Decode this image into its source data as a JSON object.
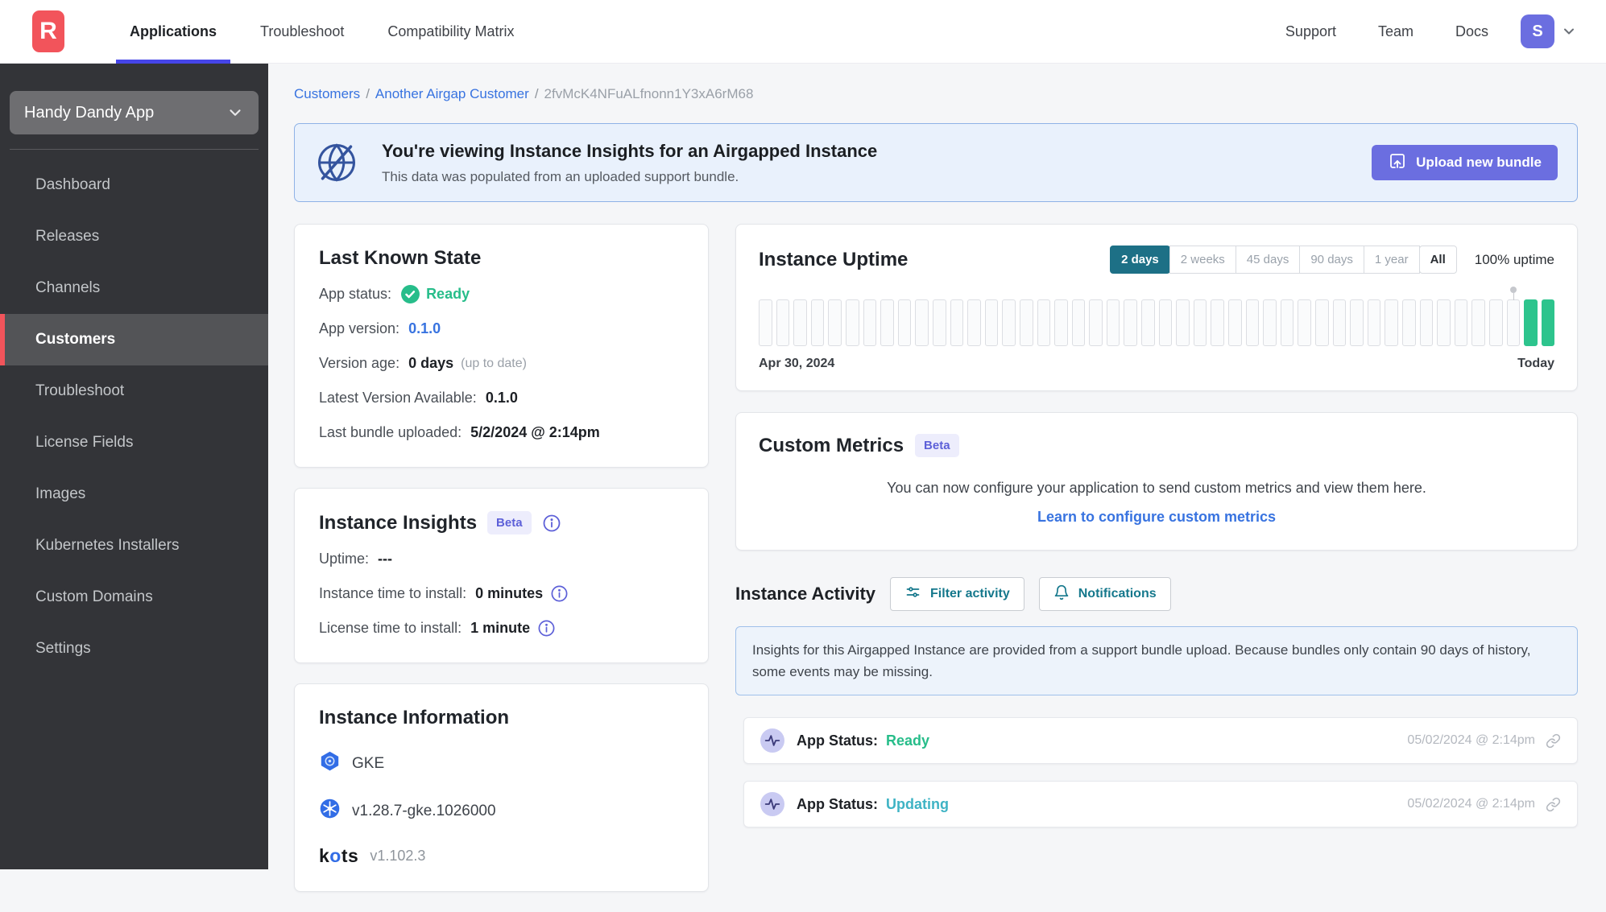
{
  "colors": {
    "brand_red": "#f2545b",
    "accent_indigo": "#6b6ee0",
    "nav_underline": "#4645e8",
    "link_blue": "#3873e0",
    "success_green": "#27bd8a",
    "uptime_bar_green": "#2dc48d",
    "updating_teal": "#3eb3c4",
    "active_range_teal": "#1d7086",
    "button_teal_text": "#15788c"
  },
  "header": {
    "logo_letter": "R",
    "nav": [
      {
        "label": "Applications",
        "active": true
      },
      {
        "label": "Troubleshoot"
      },
      {
        "label": "Compatibility Matrix"
      }
    ],
    "right_nav": [
      {
        "label": "Support"
      },
      {
        "label": "Team"
      },
      {
        "label": "Docs"
      }
    ],
    "avatar_initial": "S"
  },
  "sidebar": {
    "app_selector": "Handy Dandy App",
    "items": [
      {
        "label": "Dashboard"
      },
      {
        "label": "Releases"
      },
      {
        "label": "Channels"
      },
      {
        "label": "Customers",
        "active": true
      },
      {
        "label": "Troubleshoot"
      },
      {
        "label": "License Fields"
      },
      {
        "label": "Images"
      },
      {
        "label": "Kubernetes Installers"
      },
      {
        "label": "Custom Domains"
      },
      {
        "label": "Settings"
      }
    ]
  },
  "breadcrumb": {
    "customers": "Customers",
    "customer_name": "Another Airgap Customer",
    "instance_id": "2fvMcK4NFuALfnonn1Y3xA6rM68",
    "separator": "/"
  },
  "banner": {
    "title": "You're viewing Instance Insights for an Airgapped Instance",
    "subtitle": "This data was populated from an uploaded support bundle.",
    "button_label": "Upload new bundle"
  },
  "last_known_state": {
    "title": "Last Known State",
    "app_status_label": "App status:",
    "app_status_value": "Ready",
    "app_version_label": "App version:",
    "app_version_value": "0.1.0",
    "version_age_label": "Version age:",
    "version_age_value": "0 days",
    "version_age_note": "(up to date)",
    "latest_version_label": "Latest Version Available:",
    "latest_version_value": "0.1.0",
    "last_bundle_label": "Last bundle uploaded:",
    "last_bundle_value": "5/2/2024 @ 2:14pm"
  },
  "instance_insights": {
    "title": "Instance Insights",
    "badge": "Beta",
    "uptime_label": "Uptime:",
    "uptime_value": "---",
    "instance_install_label": "Instance time to install:",
    "instance_install_value": "0 minutes",
    "license_install_label": "License time to install:",
    "license_install_value": "1 minute"
  },
  "instance_information": {
    "title": "Instance Information",
    "distribution": "GKE",
    "k8s_version": "v1.28.7-gke.1026000",
    "kots_k": "k",
    "kots_o": "o",
    "kots_ts": "ts",
    "kots_version": "v1.102.3"
  },
  "uptime": {
    "title": "Instance Uptime",
    "ranges": [
      {
        "label": "2 days",
        "active": true
      },
      {
        "label": "2 weeks"
      },
      {
        "label": "45 days"
      },
      {
        "label": "90 days"
      },
      {
        "label": "1 year"
      },
      {
        "label": "All",
        "boxed": true
      }
    ],
    "uptime_pct": "100% uptime",
    "start_label": "Apr 30, 2024",
    "end_label": "Today",
    "bars": {
      "total": 46,
      "filled_tail": 2,
      "marker_index": 43
    }
  },
  "custom_metrics": {
    "title": "Custom Metrics",
    "badge": "Beta",
    "body": "You can now configure your application to send custom metrics and view them here.",
    "link": "Learn to configure custom metrics"
  },
  "activity": {
    "title": "Instance Activity",
    "filter_button": "Filter activity",
    "notifications_button": "Notifications",
    "note": "Insights for this Airgapped Instance are provided from a support bundle upload. Because bundles only contain 90 days of history, some events may be missing.",
    "rows": [
      {
        "label": "App Status:",
        "status": "Ready",
        "ready": true,
        "timestamp": "05/02/2024 @ 2:14pm"
      },
      {
        "label": "App Status:",
        "status": "Updating",
        "updating": true,
        "timestamp": "05/02/2024 @ 2:14pm"
      }
    ]
  }
}
